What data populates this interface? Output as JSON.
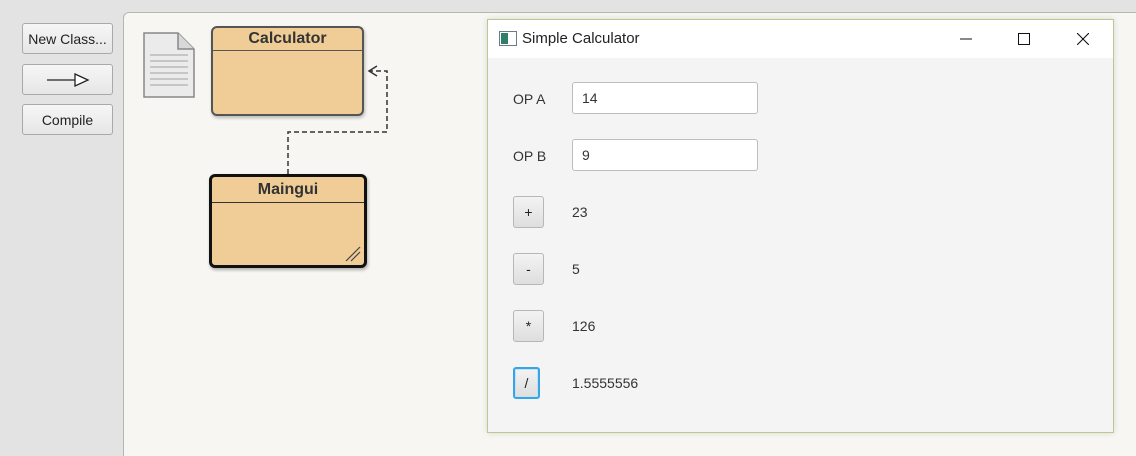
{
  "toolbar": {
    "new_class_label": "New Class...",
    "compile_label": "Compile"
  },
  "diagram": {
    "classes": [
      {
        "name": "Calculator"
      },
      {
        "name": "Maingui"
      }
    ]
  },
  "window": {
    "title": "Simple Calculator",
    "op_a_label": "OP A",
    "op_a_value": "14",
    "op_b_label": "OP B",
    "op_b_value": "9",
    "operations": [
      {
        "symbol": "+",
        "result": "23"
      },
      {
        "symbol": "-",
        "result": "5"
      },
      {
        "symbol": "*",
        "result": "126"
      },
      {
        "symbol": "/",
        "result": "1.5555556"
      }
    ]
  },
  "colors": {
    "class_fill": "#f0cc96",
    "focus_ring": "#3aa3e3",
    "window_border": "#b9c98f"
  }
}
